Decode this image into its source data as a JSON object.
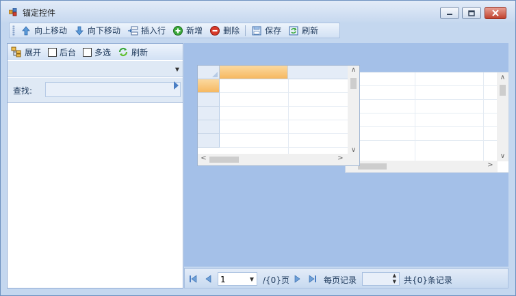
{
  "window": {
    "title": "锚定控件"
  },
  "title_buttons": {
    "minimize": "minimize-icon",
    "maximize": "maximize-icon",
    "close": "close-icon"
  },
  "toolbar": {
    "move_up": "向上移动",
    "move_down": "向下移动",
    "insert_row": "插入行",
    "add": "新增",
    "delete": "删除",
    "save": "保存",
    "refresh": "刷新"
  },
  "left_panel": {
    "expand": "展开",
    "background": "后台",
    "multi_select": "多选",
    "refresh": "刷新",
    "search_label": "查找:",
    "search_value": ""
  },
  "pager": {
    "page_value": "1",
    "page_total": "/{0}页",
    "per_page_label": "每页记录",
    "per_page_value": "",
    "total_records": "共{0}条记录"
  },
  "colors": {
    "accent": "#4a7ec4",
    "selected_header": "#f9c77c",
    "panel_bg": "#a4c0e8"
  }
}
